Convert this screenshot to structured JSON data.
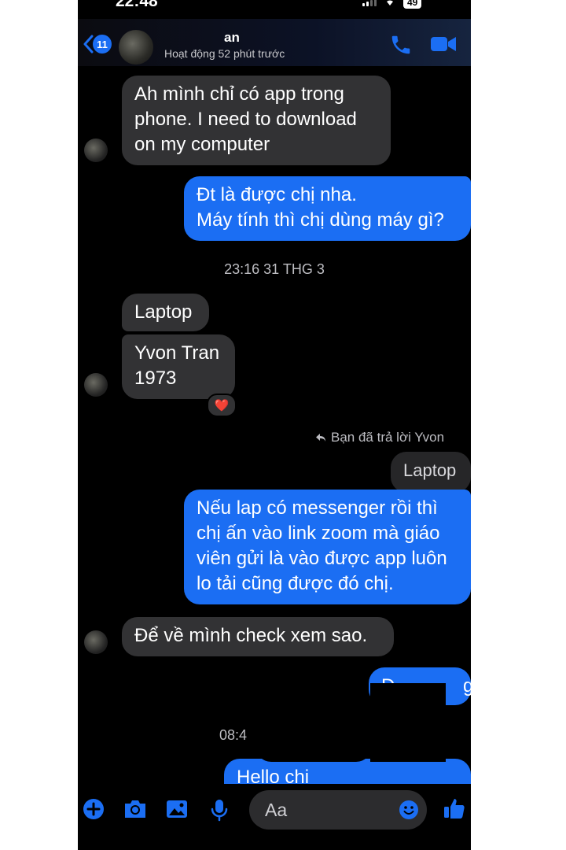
{
  "status_bar": {
    "time": "22:48",
    "battery": "49"
  },
  "header": {
    "unread_count": "11",
    "contact_name": "an",
    "contact_status": "Hoạt động 52 phút trước"
  },
  "messages": [
    {
      "side": "received",
      "text": "Ah mình chỉ có app trong\nphone. I need to download\non my computer"
    },
    {
      "side": "sent",
      "text": "Đt là được chị nha.\nMáy tính thì chị dùng máy gì?"
    },
    {
      "side": "timestamp",
      "text": "23:16 31 THG 3"
    },
    {
      "side": "received",
      "text": "Laptop"
    },
    {
      "side": "received",
      "text": "Yvon Tran\n1973",
      "reaction": "❤️"
    },
    {
      "side": "reply_note",
      "text": "Bạn đã trả lời Yvon"
    },
    {
      "side": "quoted",
      "text": "Laptop"
    },
    {
      "side": "sent",
      "text": "Nếu lap có messenger rồi thì\nchị ấn vào link zoom mà giáo\nviên gửi là vào được app luôn\nlo tải cũng được đó chị."
    },
    {
      "side": "received",
      "text": "Để về mình check xem sao."
    },
    {
      "side": "sent",
      "text": "D             g."
    },
    {
      "side": "timestamp",
      "text": "08:4"
    },
    {
      "side": "sent",
      "text": "Hello chị"
    }
  ],
  "composer": {
    "placeholder": "Aa"
  },
  "colors": {
    "accent": "#1b6ef3",
    "received_bubble": "#323234",
    "background": "#000000"
  }
}
